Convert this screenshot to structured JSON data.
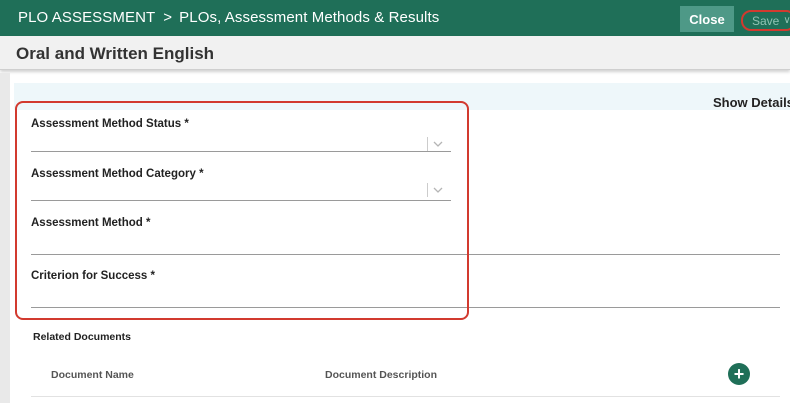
{
  "header": {
    "breadcrumb_root": "PLO ASSESSMENT",
    "breadcrumb_separator": ">",
    "breadcrumb_current": "PLOs, Assessment Methods & Results",
    "close_label": "Close",
    "save_label": "Save",
    "background_color": "#1f6f58"
  },
  "page": {
    "title": "Oral and Written English",
    "show_details_label": "Show Details"
  },
  "form": {
    "status_label": "Assessment Method Status *",
    "category_label": "Assessment Method Category *",
    "method_label": "Assessment Method *",
    "criterion_label": "Criterion for Success *"
  },
  "related_documents": {
    "title": "Related Documents",
    "columns": [
      "Document Name",
      "Document Description"
    ]
  },
  "icons": {
    "dropdown": "chevron-down-icon",
    "add": "plus-icon"
  }
}
